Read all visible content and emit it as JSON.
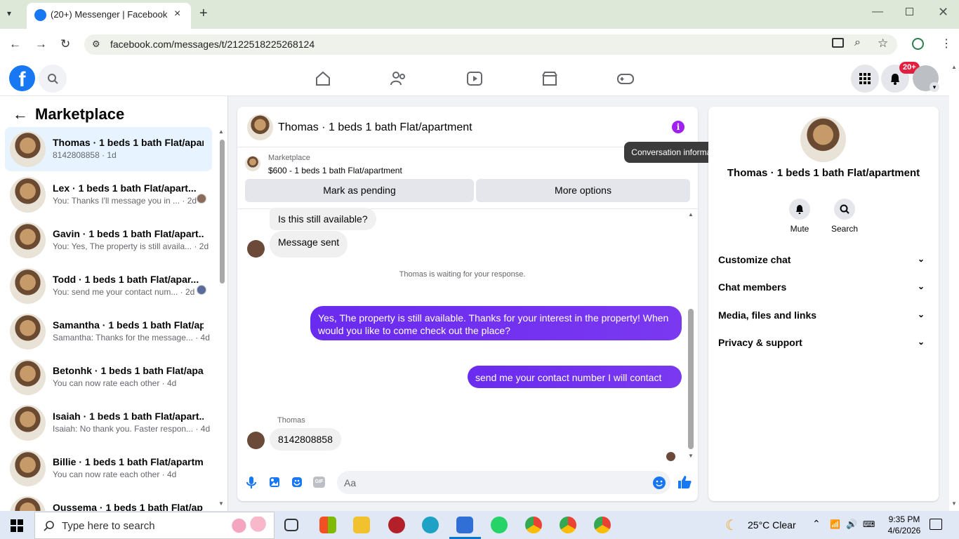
{
  "browser": {
    "tab_title": "(20+) Messenger | Facebook",
    "url": "facebook.com/messages/t/2122518225268124"
  },
  "header": {
    "notification_badge": "20+"
  },
  "marketplace": {
    "title": "Marketplace",
    "conversations": [
      {
        "name": "Thomas · 1 beds 1 bath Flat/apar...",
        "sub": "8142808858 · 1d"
      },
      {
        "name": "Lex · 1 beds 1 bath Flat/apart...",
        "sub": "You: Thanks I'll message you in ... · 2d"
      },
      {
        "name": "Gavin · 1 beds 1 bath Flat/apart...",
        "sub": "You: Yes, The property is still availa... · 2d"
      },
      {
        "name": "Todd · 1 beds 1 bath Flat/apar...",
        "sub": "You: send me your contact num... · 2d"
      },
      {
        "name": "Samantha · 1 beds 1 bath Flat/ap...",
        "sub": "Samantha: Thanks for the message... · 4d"
      },
      {
        "name": "Betonhk · 1 beds 1 bath Flat/apa...",
        "sub": "You can now rate each other · 4d"
      },
      {
        "name": "Isaiah · 1 beds 1 bath Flat/apart...",
        "sub": "Isaiah: No thank you. Faster respon... · 4d"
      },
      {
        "name": "Billie · 1 beds 1 bath Flat/apartm...",
        "sub": "You can now rate each other · 4d"
      },
      {
        "name": "Oussema · 1 beds 1 bath Flat/ap...",
        "sub": ""
      }
    ]
  },
  "chat": {
    "title": "Thomas · 1 beds 1 bath Flat/apartment",
    "tooltip": "Conversation information",
    "listing_label": "Marketplace",
    "listing_title": "$600 - 1 beds 1 bath Flat/apartment",
    "btn_pending": "Mark as pending",
    "btn_more": "More options",
    "msg1": "Is this still available?",
    "msg2": "Message sent",
    "waiting": "Thomas is waiting for your response.",
    "msg3": "Yes, The property is still available. Thanks for your interest in the property! When would you like to come check out the place?",
    "msg4": "send me your contact number I will contact you",
    "sender_label": "Thomas",
    "msg5": "8142808858",
    "composer_placeholder": "Aa"
  },
  "info_panel": {
    "name": "Thomas · 1 beds 1 bath Flat/apartment",
    "mute": "Mute",
    "search": "Search",
    "sections": [
      "Customize chat",
      "Chat members",
      "Media, files and links",
      "Privacy & support"
    ]
  },
  "taskbar": {
    "search_placeholder": "Type here to search",
    "weather": "25°C  Clear",
    "time": "9:35 PM",
    "date": "4/6/2026"
  },
  "colors": {
    "accent": "#7b2ff7",
    "fb_blue": "#1877f2",
    "badge": "#e41e3f"
  }
}
